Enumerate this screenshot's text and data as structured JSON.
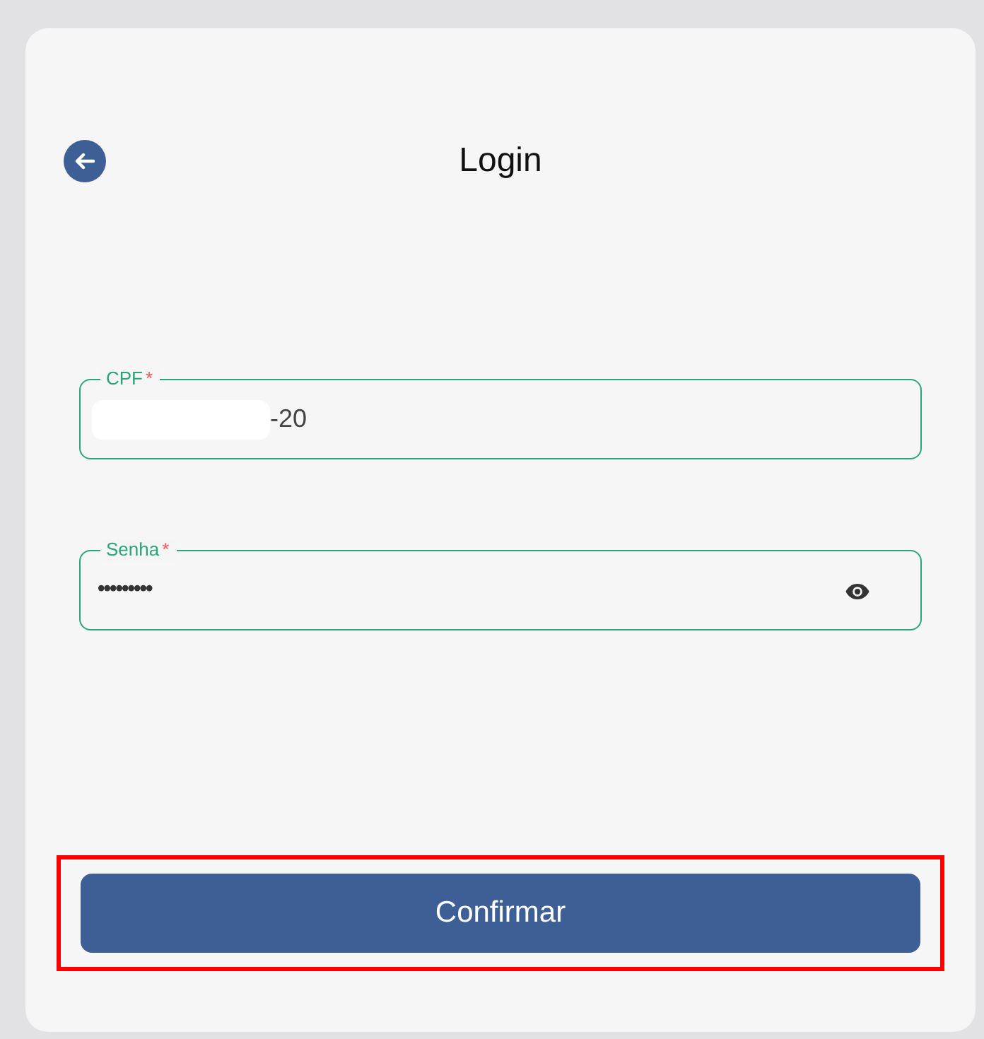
{
  "header": {
    "title": "Login"
  },
  "fields": [
    {
      "label": "CPF",
      "required_mark": "*",
      "value": "-20",
      "redacted": true,
      "kind": "text"
    },
    {
      "label": "Senha",
      "required_mark": "*",
      "value": "•••••••••",
      "kind": "password"
    }
  ],
  "submit_button": {
    "label": "Confirmar",
    "highlighted": true
  }
}
